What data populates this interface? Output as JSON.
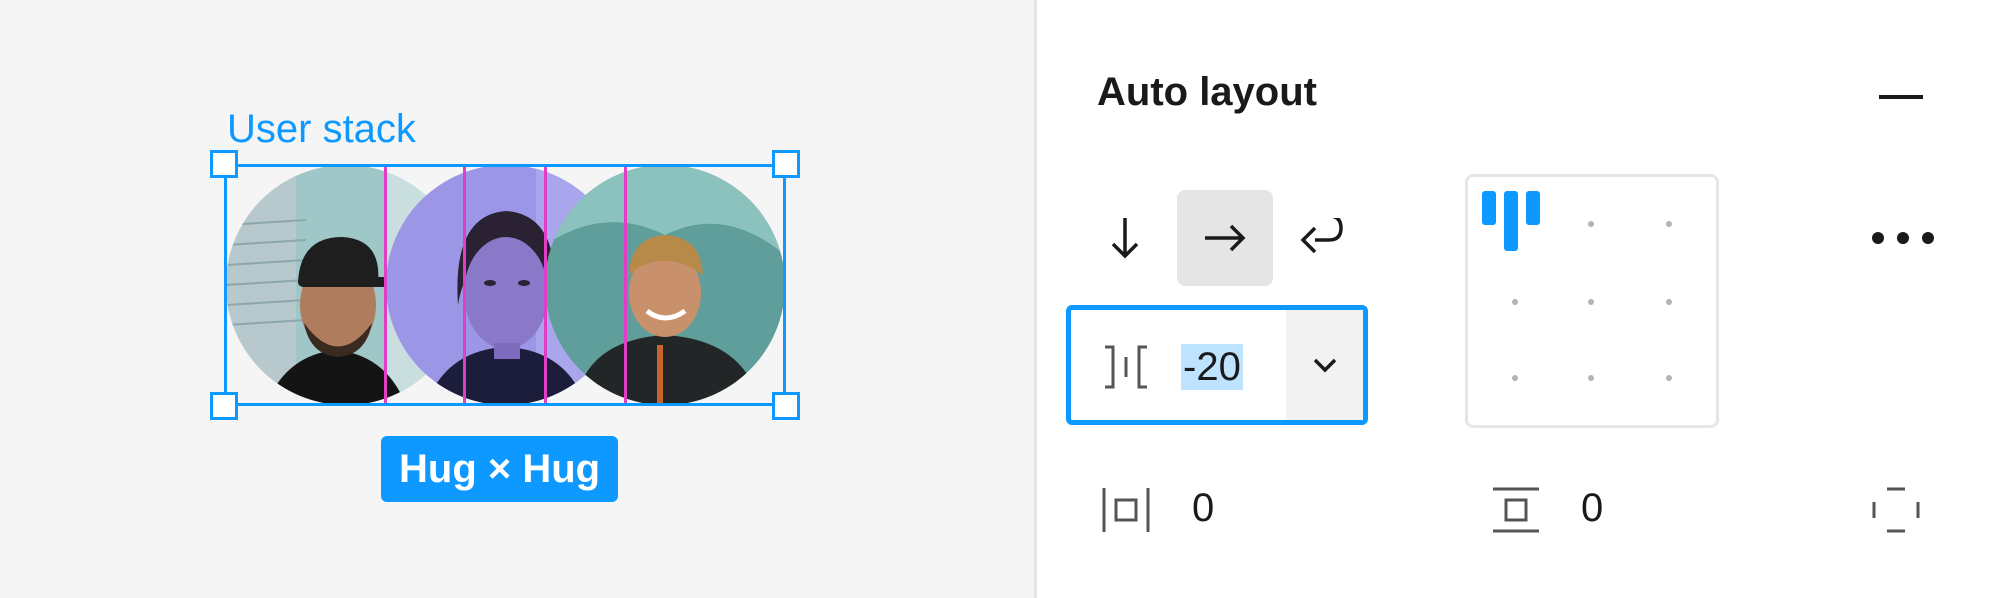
{
  "canvas": {
    "frame_label": "User stack",
    "size_badge": "Hug × Hug",
    "avatars": [
      "avatar-person-cap",
      "avatar-person-woman",
      "avatar-person-smiling"
    ]
  },
  "panel": {
    "title": "Auto layout",
    "collapse_icon": "minus-icon",
    "direction": {
      "options": [
        "vertical-arrow-down-icon",
        "horizontal-arrow-right-icon",
        "wrap-arrow-icon"
      ],
      "selected": "horizontal"
    },
    "gap": {
      "value": "-20",
      "icon": "gap-between-icon",
      "dropdown_icon": "chevron-down-icon"
    },
    "alignment": {
      "selected": "top-left"
    },
    "more_icon": "more-dots-icon",
    "padding": {
      "horizontal": "0",
      "vertical": "0",
      "horizontal_icon": "horizontal-padding-icon",
      "vertical_icon": "vertical-padding-icon",
      "individual_icon": "individual-padding-icon"
    }
  },
  "colors": {
    "accent": "#0d99ff",
    "gap_highlight": "#e23dc7",
    "selection_text_bg": "#bde3ff"
  }
}
